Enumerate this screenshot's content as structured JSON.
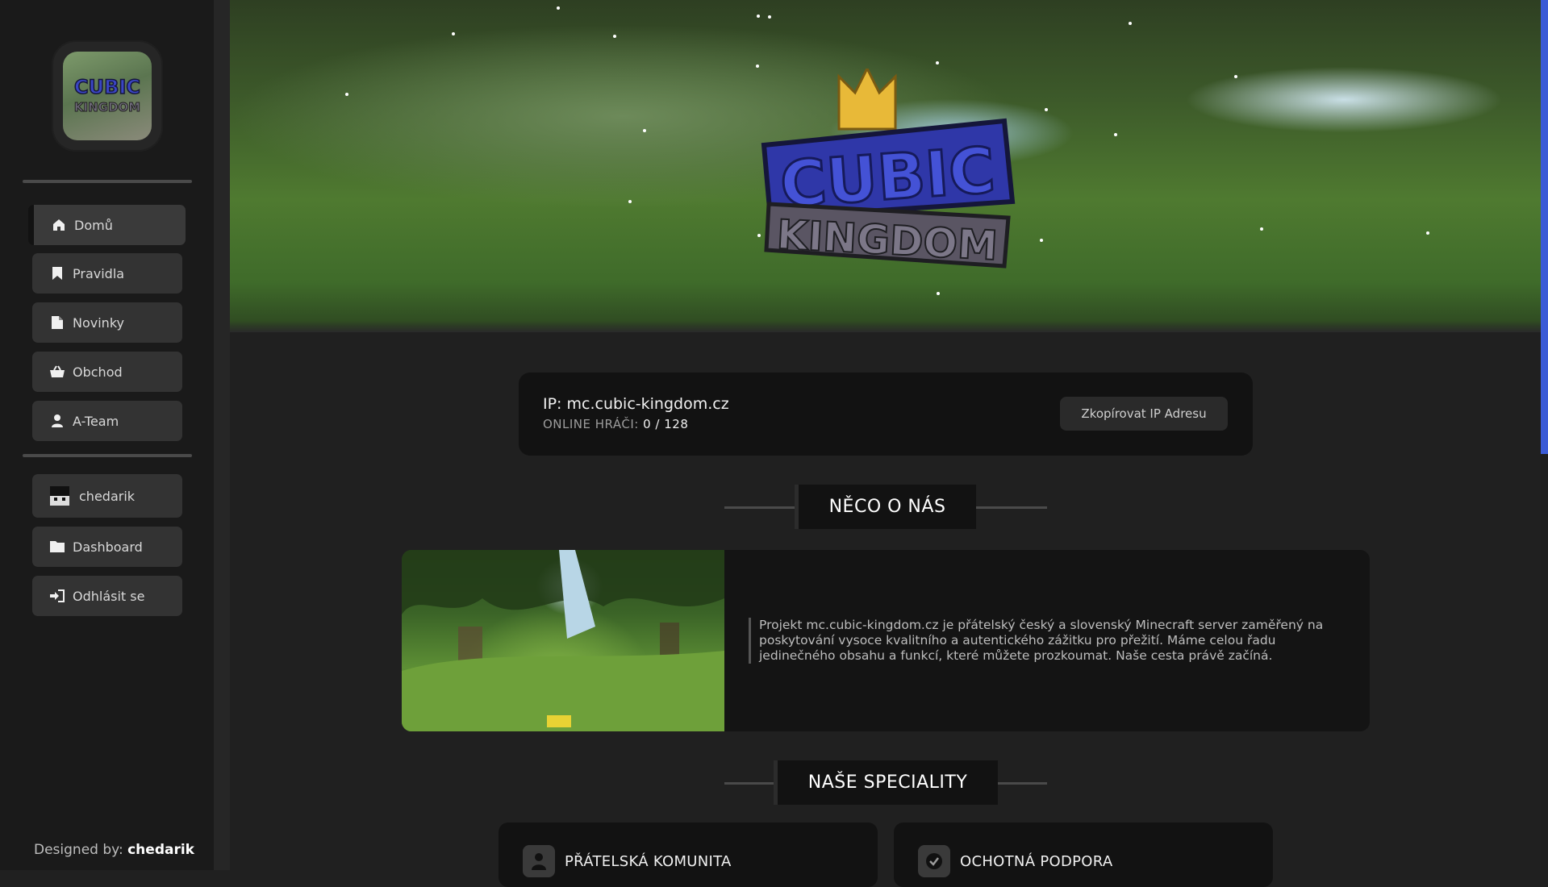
{
  "sidebar": {
    "logo_text": [
      "CUBIC",
      "KINGDOM"
    ],
    "nav": [
      {
        "label": "Domů",
        "icon": "home-icon"
      },
      {
        "label": "Pravidla",
        "icon": "bookmark-icon"
      },
      {
        "label": "Novinky",
        "icon": "document-icon"
      },
      {
        "label": "Obchod",
        "icon": "basket-icon"
      },
      {
        "label": "A-Team",
        "icon": "user-icon"
      }
    ],
    "account": [
      {
        "label": "chedarik",
        "icon": "avatar-icon"
      },
      {
        "label": "Dashboard",
        "icon": "folder-icon"
      },
      {
        "label": "Odhlásit se",
        "icon": "logout-icon"
      }
    ],
    "designed_by_label": "Designed by:",
    "designed_by_name": "chedarik"
  },
  "banner": {
    "logo_text": [
      "CUBIC",
      "KINGDOM"
    ]
  },
  "server": {
    "ip_label": "IP:",
    "ip": "mc.cubic-kingdom.cz",
    "online_label": "ONLINE HRÁČI:",
    "online_value": "0 / 128",
    "copy_button": "Zkopírovat IP Adresu"
  },
  "sections": {
    "about_title": "NĚCO O NÁS",
    "about_text": "Projekt mc.cubic-kingdom.cz je přátelský český a slovenský Minecraft server zaměřený na poskytování vysoce kvalitního a autentického zážitku pro přežití. Máme celou řadu jedinečného obsahu a funkcí, které můžete prozkoumat. Naše cesta právě začíná.",
    "specials_title": "NAŠE SPECIALITY",
    "features": [
      {
        "title": "PŘÁTELSKÁ KOMUNITA",
        "icon": "user-icon"
      },
      {
        "title": "OCHOTNÁ PODPORA",
        "icon": "check-badge-icon"
      }
    ]
  },
  "colors": {
    "accent": "#3b5bd6",
    "background": "#202020",
    "sidebar": "#1a1a1a",
    "card": "#121212",
    "logo_gold": "#e8b938",
    "logo_blue": "#3a45c4"
  }
}
